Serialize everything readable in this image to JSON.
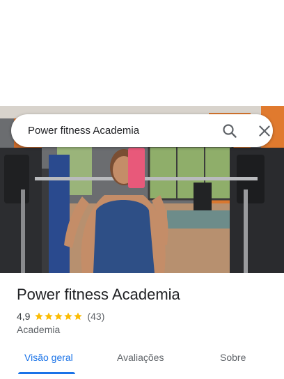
{
  "search": {
    "query": "Power fitness Academia"
  },
  "photo": {
    "icon": "gym-photo"
  },
  "place": {
    "name": "Power fitness Academia",
    "rating": "4,9",
    "stars": 5,
    "review_count": "(43)",
    "category": "Academia"
  },
  "tabs": [
    {
      "label": "Visão geral",
      "active": true
    },
    {
      "label": "Avaliações",
      "active": false
    },
    {
      "label": "Sobre",
      "active": false
    }
  ],
  "colors": {
    "accent": "#1a73e8",
    "star": "#fbbc04",
    "text_primary": "#202124",
    "text_secondary": "#5f6368"
  }
}
